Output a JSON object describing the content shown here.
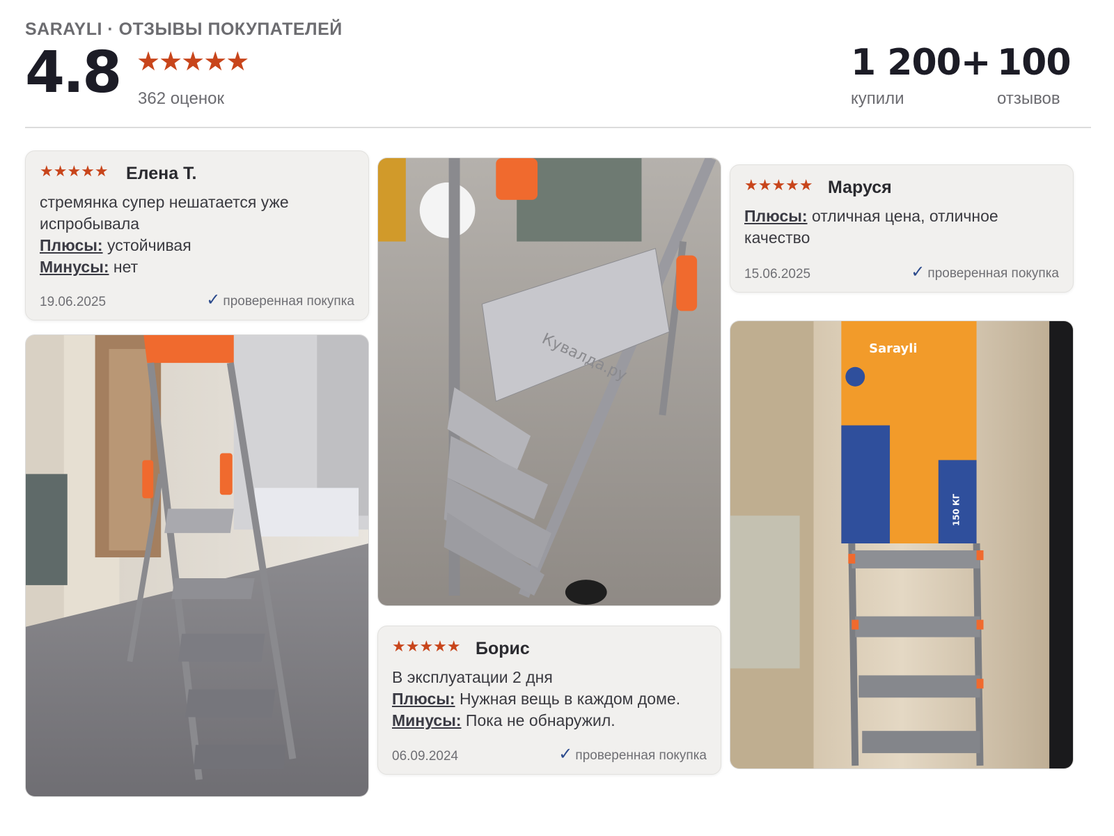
{
  "header": {
    "brand": "SARAYLI · ОТЗЫВЫ ПОКУПАТЕЛЕЙ",
    "rating": "4.8",
    "stars": "★★★★★",
    "ratings_count": "362 оценок",
    "bought_value": "1 200+",
    "bought_label": "купили",
    "reviews_value": "100",
    "reviews_label": "отзывов"
  },
  "reviews": [
    {
      "stars": "★★★★★",
      "author": "Елена Т.",
      "text": "стремянка супер нешатается уже испробывала",
      "pros_label": "Плюсы:",
      "pros": "устойчивая",
      "cons_label": "Минусы:",
      "cons": "нет",
      "date": "19.06.2025",
      "verified": "проверенная покупка"
    },
    {
      "stars": "★★★★★",
      "author": "Борис",
      "text": "В эксплуатации 2 дня",
      "pros_label": "Плюсы:",
      "pros": "Нужная вещь в каждом доме.",
      "cons_label": "Минусы:",
      "cons": "Пока не обнаружил.",
      "date": "06.09.2024",
      "verified": "проверенная покупка"
    },
    {
      "stars": "★★★★★",
      "author": "Маруся",
      "pros_label": "Плюсы:",
      "pros": "отличная цена, отличное качество",
      "date": "15.06.2025",
      "verified": "проверенная покупка"
    }
  ],
  "photos": {
    "step_text": "Кувалда.ру",
    "package_brand": "Sarayli",
    "package_load": "150 КГ"
  },
  "colors": {
    "accent_star": "#c8451b",
    "ladder_orange": "#f06a2e",
    "check_blue": "#2b4a8c",
    "card_bg": "#f1f0ee"
  },
  "icons": {
    "verified": "checkmark-icon",
    "rating": "star-icon"
  }
}
